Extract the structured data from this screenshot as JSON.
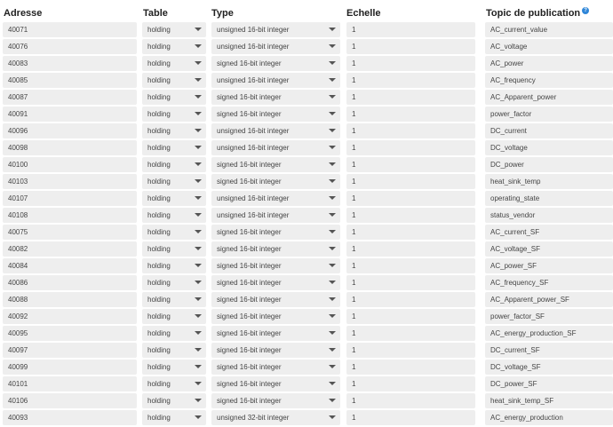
{
  "columns": {
    "address": "Adresse",
    "table": "Table",
    "type": "Type",
    "scale": "Echelle",
    "topic": "Topic de publication",
    "topic_help_icon": "question-circle-icon"
  },
  "rows": [
    {
      "address": "40071",
      "table": "holding",
      "type": "unsigned 16-bit integer",
      "scale": "1",
      "topic": "AC_current_value"
    },
    {
      "address": "40076",
      "table": "holding",
      "type": "unsigned 16-bit integer",
      "scale": "1",
      "topic": "AC_voltage"
    },
    {
      "address": "40083",
      "table": "holding",
      "type": "signed 16-bit integer",
      "scale": "1",
      "topic": "AC_power"
    },
    {
      "address": "40085",
      "table": "holding",
      "type": "unsigned 16-bit integer",
      "scale": "1",
      "topic": "AC_frequency"
    },
    {
      "address": "40087",
      "table": "holding",
      "type": "signed 16-bit integer",
      "scale": "1",
      "topic": "AC_Apparent_power"
    },
    {
      "address": "40091",
      "table": "holding",
      "type": "signed 16-bit integer",
      "scale": "1",
      "topic": "power_factor"
    },
    {
      "address": "40096",
      "table": "holding",
      "type": "unsigned 16-bit integer",
      "scale": "1",
      "topic": "DC_current"
    },
    {
      "address": "40098",
      "table": "holding",
      "type": "unsigned 16-bit integer",
      "scale": "1",
      "topic": "DC_voltage"
    },
    {
      "address": "40100",
      "table": "holding",
      "type": "signed 16-bit integer",
      "scale": "1",
      "topic": "DC_power"
    },
    {
      "address": "40103",
      "table": "holding",
      "type": "signed 16-bit integer",
      "scale": "1",
      "topic": "heat_sink_temp"
    },
    {
      "address": "40107",
      "table": "holding",
      "type": "unsigned 16-bit integer",
      "scale": "1",
      "topic": "operating_state"
    },
    {
      "address": "40108",
      "table": "holding",
      "type": "unsigned 16-bit integer",
      "scale": "1",
      "topic": "status_vendor"
    },
    {
      "address": "40075",
      "table": "holding",
      "type": "signed 16-bit integer",
      "scale": "1",
      "topic": "AC_current_SF"
    },
    {
      "address": "40082",
      "table": "holding",
      "type": "signed 16-bit integer",
      "scale": "1",
      "topic": "AC_voltage_SF"
    },
    {
      "address": "40084",
      "table": "holding",
      "type": "signed 16-bit integer",
      "scale": "1",
      "topic": "AC_power_SF"
    },
    {
      "address": "40086",
      "table": "holding",
      "type": "signed 16-bit integer",
      "scale": "1",
      "topic": "AC_frequency_SF"
    },
    {
      "address": "40088",
      "table": "holding",
      "type": "signed 16-bit integer",
      "scale": "1",
      "topic": "AC_Apparent_power_SF"
    },
    {
      "address": "40092",
      "table": "holding",
      "type": "signed 16-bit integer",
      "scale": "1",
      "topic": "power_factor_SF"
    },
    {
      "address": "40095",
      "table": "holding",
      "type": "signed 16-bit integer",
      "scale": "1",
      "topic": "AC_energy_production_SF"
    },
    {
      "address": "40097",
      "table": "holding",
      "type": "signed 16-bit integer",
      "scale": "1",
      "topic": "DC_current_SF"
    },
    {
      "address": "40099",
      "table": "holding",
      "type": "signed 16-bit integer",
      "scale": "1",
      "topic": "DC_voltage_SF"
    },
    {
      "address": "40101",
      "table": "holding",
      "type": "signed 16-bit integer",
      "scale": "1",
      "topic": "DC_power_SF"
    },
    {
      "address": "40106",
      "table": "holding",
      "type": "signed 16-bit integer",
      "scale": "1",
      "topic": "heat_sink_temp_SF"
    },
    {
      "address": "40093",
      "table": "holding",
      "type": "unsigned 32-bit integer",
      "scale": "1",
      "topic": "AC_energy_production"
    }
  ]
}
